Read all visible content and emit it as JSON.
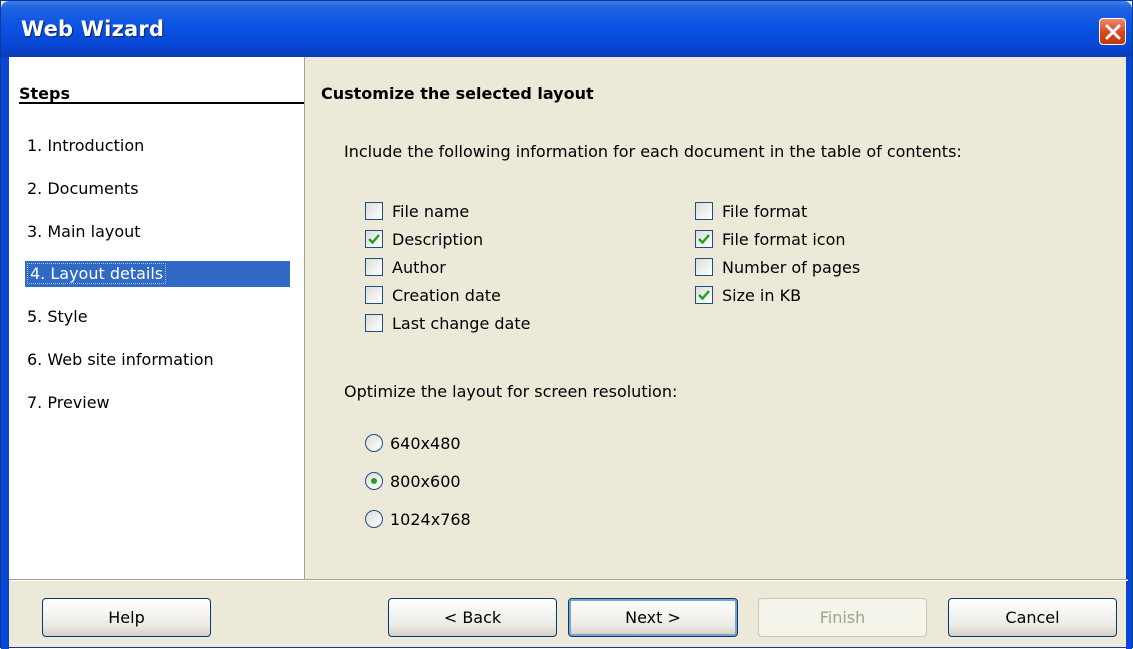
{
  "window": {
    "title": "Web Wizard"
  },
  "sidebar": {
    "heading": "Steps",
    "items": [
      {
        "label": "1.  Introduction",
        "selected": false
      },
      {
        "label": "2.  Documents",
        "selected": false
      },
      {
        "label": "3.  Main layout",
        "selected": false
      },
      {
        "label": "4.  Layout details",
        "selected": true
      },
      {
        "label": "5.  Style",
        "selected": false
      },
      {
        "label": "6.  Web site information",
        "selected": false
      },
      {
        "label": "7.  Preview",
        "selected": false
      }
    ]
  },
  "main": {
    "title": "Customize the selected layout",
    "include_prompt": "Include the following information for each document in the table of contents:",
    "checkboxes_left": [
      {
        "label": "File name",
        "checked": false
      },
      {
        "label": "Description",
        "checked": true
      },
      {
        "label": "Author",
        "checked": false
      },
      {
        "label": "Creation date",
        "checked": false
      },
      {
        "label": "Last change date",
        "checked": false
      }
    ],
    "checkboxes_right": [
      {
        "label": "File format",
        "checked": false
      },
      {
        "label": "File format icon",
        "checked": true
      },
      {
        "label": "Number of pages",
        "checked": false
      },
      {
        "label": "Size in KB",
        "checked": true
      }
    ],
    "resolution_prompt": "Optimize the layout for screen resolution:",
    "resolutions": [
      {
        "label": "640x480",
        "selected": false
      },
      {
        "label": "800x600",
        "selected": true
      },
      {
        "label": "1024x768",
        "selected": false
      }
    ]
  },
  "buttons": {
    "help": "Help",
    "back": "< Back",
    "next": "Next >",
    "finish": "Finish",
    "cancel": "Cancel"
  },
  "colors": {
    "titlebar": "#0846d4",
    "selection": "#316ac5",
    "dialog_bg": "#ece9d8",
    "check_green": "#21a121"
  },
  "icons": {
    "close": "close-icon",
    "check": "check-icon"
  }
}
